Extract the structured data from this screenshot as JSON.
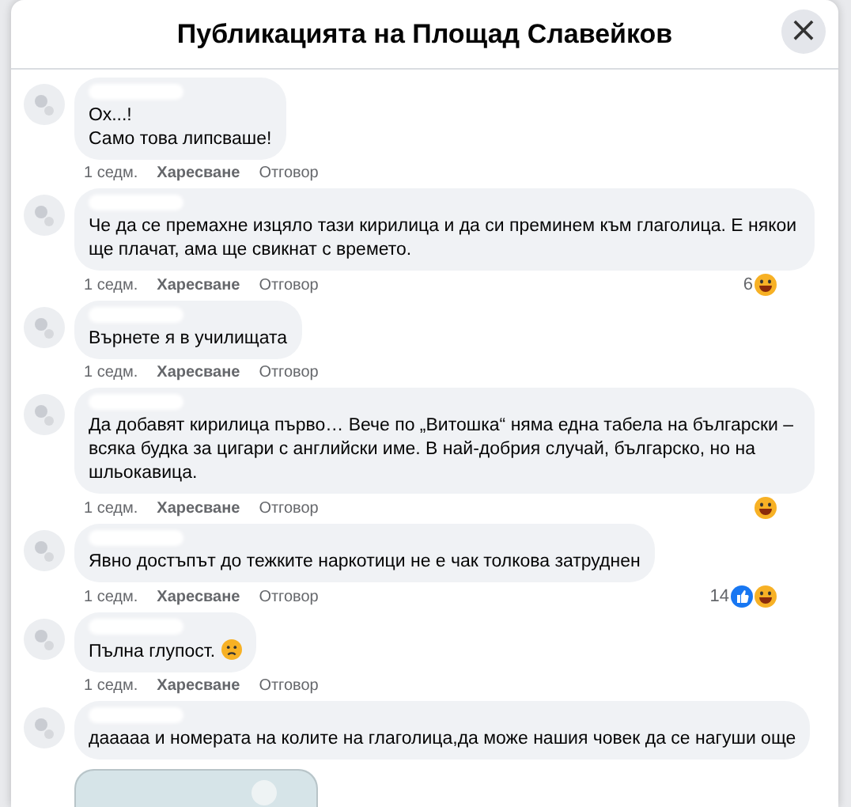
{
  "dialog": {
    "title": "Публикацията на Площад Славейков",
    "close": "×"
  },
  "comments": [
    {
      "lines": [
        "Ох...!",
        "Само това липсваше!"
      ],
      "time": "1 седм.",
      "like": "Харесване",
      "reply": "Отговор"
    },
    {
      "lines": [
        "Че да се премахне изцяло тази кирилица и да си преминем към глаголица. Е някои ще плачат, ама ще свикнат с времето."
      ],
      "time": "1 седм.",
      "like": "Харесване",
      "reply": "Отговор",
      "reactions": [
        {
          "kind": "haha"
        }
      ],
      "count": "6"
    },
    {
      "lines": [
        "Върнете я в училищата"
      ],
      "time": "1 седм.",
      "like": "Харесване",
      "reply": "Отговор"
    },
    {
      "lines": [
        "Да добавят кирилица първо… Вече по „Витошка“ няма една табела на български – всяка будка за цигари с английски име. В най-добрия случай, българско, но на шльокавица."
      ],
      "time": "1 седм.",
      "like": "Харесване",
      "reply": "Отговор",
      "reactions": [
        {
          "kind": "haha"
        }
      ]
    },
    {
      "lines": [
        "Явно достъпът до тежките наркотици не е чак толкова затруднен"
      ],
      "time": "1 седм.",
      "like": "Харесване",
      "reply": "Отговор",
      "reactions": [
        {
          "kind": "like"
        },
        {
          "kind": "haha"
        }
      ],
      "count": "14"
    },
    {
      "lines": [
        "Пълна глупост."
      ],
      "emoji": {
        "kind": "sad"
      },
      "time": "1 седм.",
      "like": "Харесване",
      "reply": "Отговор"
    },
    {
      "lines": [
        "дааааа и номерата на колите на глаголица,да може нашия човек да се нагуши още"
      ],
      "attachment": {
        "kind": "picture"
      }
    }
  ]
}
